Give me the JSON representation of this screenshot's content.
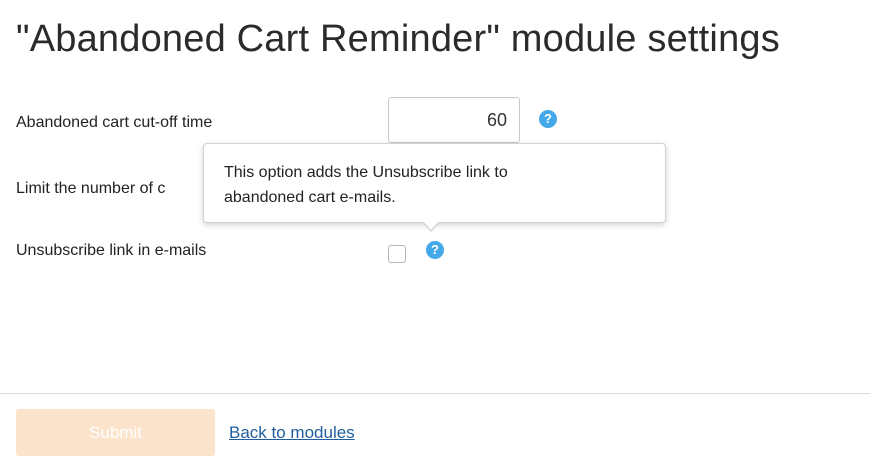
{
  "page": {
    "title": "\"Abandoned Cart Reminder\" module settings"
  },
  "form": {
    "cutoff": {
      "label": "Abandoned cart cut-off time",
      "value": "60",
      "help_icon": "question-circle-icon"
    },
    "limit": {
      "label": "Limit the number of c"
    },
    "unsubscribe": {
      "label": "Unsubscribe link in e-mails",
      "checked": false,
      "help_icon": "question-circle-icon"
    }
  },
  "tooltip": {
    "line1": "This option adds the Unsubscribe link to",
    "line2": "abandoned cart e-mails."
  },
  "footer": {
    "submit_label": "Submit",
    "back_label": "Back to modules"
  },
  "colors": {
    "help_icon": "#45a8e8",
    "submit_bg": "#fbe3cc",
    "link": "#1f5e9e"
  }
}
